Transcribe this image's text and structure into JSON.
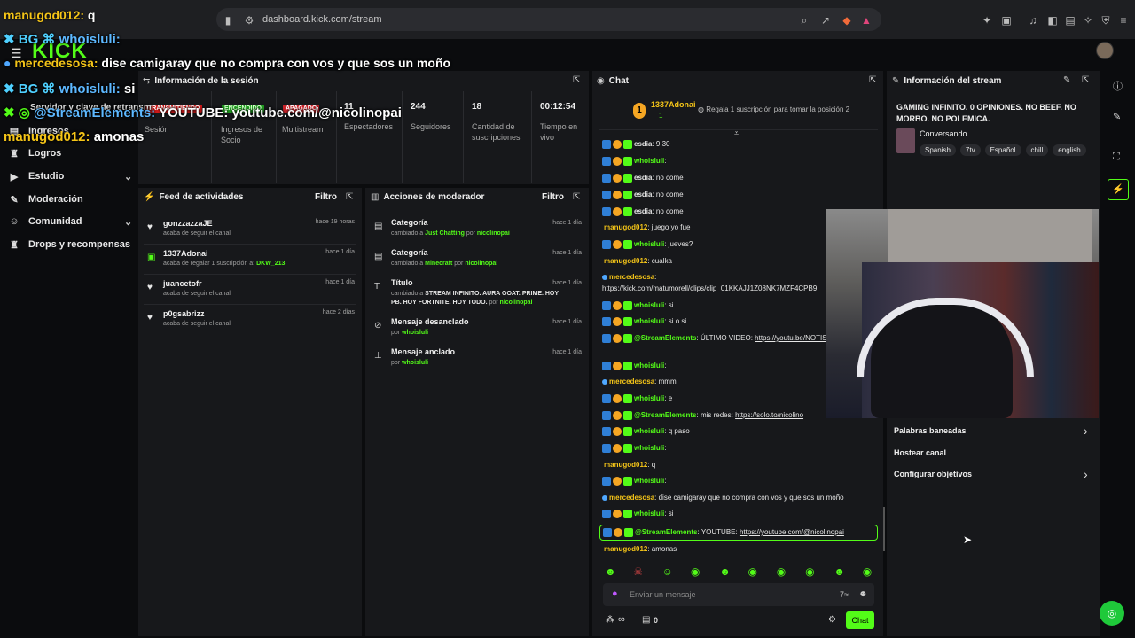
{
  "browser": {
    "url": "dashboard.kick.com/stream",
    "overlay_top_text": "manugod012: q"
  },
  "logo": "KICK",
  "sidebar": {
    "items": [
      {
        "label": "Ingresos",
        "icon": "wallet-icon"
      },
      {
        "label": "Logros",
        "icon": "trophy-icon"
      },
      {
        "label": "Estudio",
        "icon": "video-icon",
        "expand": true
      },
      {
        "label": "Moderación",
        "icon": "wrench-icon"
      },
      {
        "label": "Comunidad",
        "icon": "person-icon",
        "expand": true
      },
      {
        "label": "Drops y recompensas",
        "icon": "trophy-icon"
      }
    ]
  },
  "overlay": {
    "line1_user": "whoisluli:",
    "line2_user": "mercedesosa:",
    "line2_text": "dise camigaray que no compra con vos y que sos un moño",
    "line3_user": "whoisluli:",
    "line3_text": "si",
    "line4_user": "@StreamElements:",
    "line4_text": "YOUTUBE: youtube.com/@nicolinopai",
    "line4_under": "Servidor y clave de retransm",
    "line5_user": "manugod012:",
    "line5_text": "amonas"
  },
  "session": {
    "title": "Información de la sesión",
    "badges": {
      "live": "TRANSMITIENDO",
      "on": "ENCENDIDO",
      "off": "APAGADO"
    },
    "stats": [
      {
        "value": "",
        "label": "Sesión"
      },
      {
        "value": "",
        "label": "Ingresos de Socio"
      },
      {
        "value": "",
        "label": "Multistream"
      },
      {
        "value": "11",
        "label": "Espectadores"
      },
      {
        "value": "244",
        "label": "Seguidores"
      },
      {
        "value": "18",
        "label": "Cantidad de suscripciones"
      },
      {
        "value": "00:12:54",
        "label": "Tiempo en vivo"
      }
    ]
  },
  "feed": {
    "title": "Feed de actividades",
    "filter": "Filtro",
    "items": [
      {
        "name": "gonzzazzaJE",
        "sub": "acaba de seguir el canal",
        "time": "hace 19 horas"
      },
      {
        "name": "1337Adonai",
        "sub": "acaba de regalar 1 suscripción a:",
        "sub_highlight": "DKW_213",
        "time": "hace 1 día"
      },
      {
        "name": "juancetofr",
        "sub": "acaba de seguir el canal",
        "time": "hace 1 día"
      },
      {
        "name": "p0gsabrizz",
        "sub": "acaba de seguir el canal",
        "time": "hace 2 días"
      }
    ]
  },
  "modactions": {
    "title": "Acciones de moderador",
    "filter": "Filtro",
    "items": [
      {
        "title": "Categoría",
        "pre": "cambiado a",
        "highlight": "Just Chatting",
        "by": "por",
        "user": "nicolinopai",
        "time": "hace 1 día"
      },
      {
        "title": "Categoría",
        "pre": "cambiado a",
        "highlight": "Minecraft",
        "by": "por",
        "user": "nicolinopai",
        "time": "hace 1 día"
      },
      {
        "title": "Título",
        "pre": "cambiado a",
        "highlight": "STREAM INFINITO. AURA GOAT. PRIME. HOY PB. HOY FORTNITE. HOY TODO.",
        "by": "por",
        "user": "nicolinopai",
        "time": "hace 1 día"
      },
      {
        "title": "Mensaje desanclado",
        "pre": "",
        "highlight": "",
        "by": "por",
        "user": "whoisluli",
        "time": "hace 1 día"
      },
      {
        "title": "Mensaje anclado",
        "pre": "",
        "highlight": "",
        "by": "por",
        "user": "whoisluli",
        "time": "hace 1 día"
      }
    ]
  },
  "chat": {
    "title": "Chat",
    "gift_user": "1337Adonai",
    "gift_count": "1",
    "gift_prompt": "Regala 1 suscripción para tomar la posición 2",
    "messages": [
      {
        "user": "esdia",
        "text": "9:30",
        "color": "#e6e6e6"
      },
      {
        "user": "whoisluli",
        "text": "",
        "color": "#53fc18"
      },
      {
        "user": "esdia",
        "text": "no come",
        "color": "#e6e6e6"
      },
      {
        "user": "esdia",
        "text": "no come",
        "color": "#e6e6e6"
      },
      {
        "user": "esdia",
        "text": "no come",
        "color": "#e6e6e6"
      },
      {
        "user": "manugod012",
        "text": "juego yo fue",
        "color": "#f5c518"
      },
      {
        "user": "whoisluli",
        "text": "jueves?",
        "color": "#53fc18"
      },
      {
        "user": "manugod012",
        "text": "cualka",
        "color": "#f5c518"
      },
      {
        "user": "mercedesosa",
        "text": "",
        "color": "#f5c518"
      },
      {
        "user": "",
        "text": "https://kick.com/matumorell/clips/clip_01KKAJJ1Z08NK7MZF4CPB9",
        "color": "#e6e6e6"
      },
      {
        "user": "whoisluli",
        "text": "si",
        "color": "#53fc18"
      },
      {
        "user": "whoisluli",
        "text": "si o si",
        "color": "#53fc18"
      },
      {
        "user": "@StreamElements",
        "text": "ÚLTIMO VIDEO:",
        "link": "https://youtu.be/NOTIS",
        "color": "#53fc18"
      },
      {
        "user": "whoisluli",
        "text": "",
        "color": "#53fc18"
      },
      {
        "user": "mercedesosa",
        "text": "mmm",
        "color": "#f5c518"
      },
      {
        "user": "whoisluli",
        "text": "e",
        "color": "#53fc18"
      },
      {
        "user": "@StreamElements",
        "text": "mis redes:",
        "link": "https://solo.to/nicolino",
        "color": "#53fc18"
      },
      {
        "user": "whoisluli",
        "text": "q paso",
        "color": "#53fc18"
      },
      {
        "user": "whoisluli",
        "text": "",
        "color": "#53fc18"
      },
      {
        "user": "manugod012",
        "text": "q",
        "color": "#f5c518"
      },
      {
        "user": "whoisluli",
        "text": "",
        "color": "#53fc18"
      },
      {
        "user": "mercedesosa",
        "text": "dise camigaray que no compra con vos y que sos un moño",
        "color": "#f5c518"
      },
      {
        "user": "whoisluli",
        "text": "si",
        "color": "#53fc18"
      },
      {
        "user": "@StreamElements",
        "text": "YOUTUBE:",
        "link": "https://youtube.com/@nicolinopai",
        "color": "#53fc18",
        "highlighted": true
      },
      {
        "user": "manugod012",
        "text": "amonas",
        "color": "#f5c518"
      }
    ],
    "input_placeholder": "Enviar un mensaje",
    "viewer_count": "∞",
    "gift_counter": "0",
    "send_label": "Chat"
  },
  "info": {
    "title": "Información del stream",
    "stream_title": "GAMING INFINITO. 0 OPINIONES. NO BEEF. NO MORBO. NO POLEMICA.",
    "category": "Conversando",
    "tags": [
      "Spanish",
      "7tv",
      "Español",
      "chill",
      "english"
    ],
    "menu": [
      {
        "label": "Palabras baneadas",
        "arrow": true
      },
      {
        "label": "Hostear canal",
        "arrow": false
      },
      {
        "label": "Configurar objetivos",
        "arrow": true
      }
    ]
  },
  "colors": {
    "accent": "#53fc18",
    "panel": "#17181b",
    "bg": "#0b0c0e"
  }
}
